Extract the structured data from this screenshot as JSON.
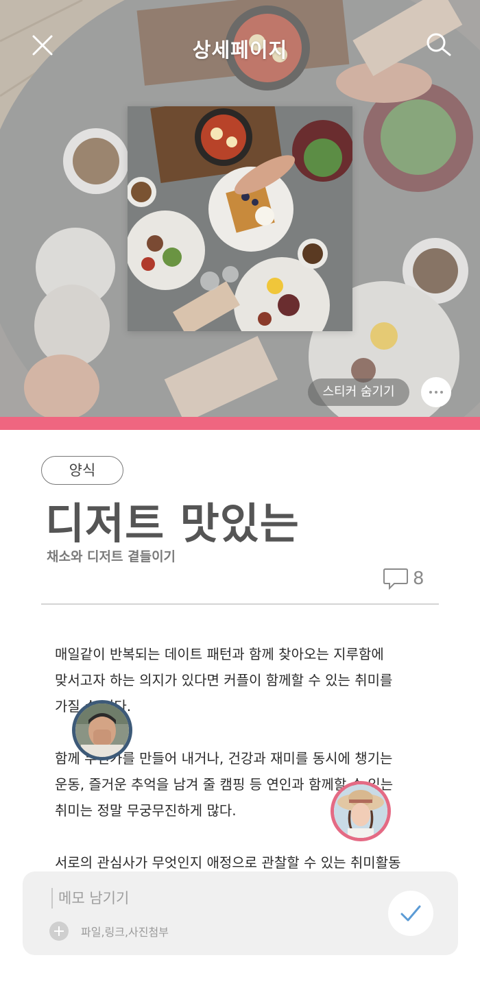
{
  "header": {
    "title": "상세페이지",
    "close_icon": "close-icon",
    "search_icon": "search-icon"
  },
  "hero": {
    "image_desc_icon": "food-table-photo",
    "sticker_toggle_label": "스티커 숨기기",
    "more_icon": "more-dots-icon",
    "accent_color": "#ef6680"
  },
  "article": {
    "category": "양식",
    "title": "디저트 맛있는",
    "subtitle": "채소와 디저트 곁들이기",
    "comment_icon": "comment-bubble-icon",
    "comment_count": "8",
    "paragraphs": [
      "매일같이 반복되는 데이트 패턴과 함께 찾아오는 지루함에\n맞서고자 하는 의지가 있다면 커플이 함께할 수 있는 취미를\n가질 수 있다.",
      "함께 무언가를 만들어 내거나, 건강과 재미를 동시에 챙기는\n운동, 즐거운 추억을 남겨 줄 캠핑 등 연인과 함께할 수 있는\n취미는 정말 무궁무진하게 많다.",
      "서로의 관심사가 무엇인지 애정으로 관찰할 수 있는 취미활동"
    ]
  },
  "stickers": {
    "avatar_1_border": "#3d5a78",
    "avatar_2_border": "#e46a84"
  },
  "memo": {
    "placeholder": "메모 남기기",
    "value": "",
    "attach_label": "파일,링크,사진첨부",
    "attach_icon": "plus-circle-icon",
    "submit_icon": "checkmark-icon",
    "submit_color": "#5b9bd5"
  }
}
